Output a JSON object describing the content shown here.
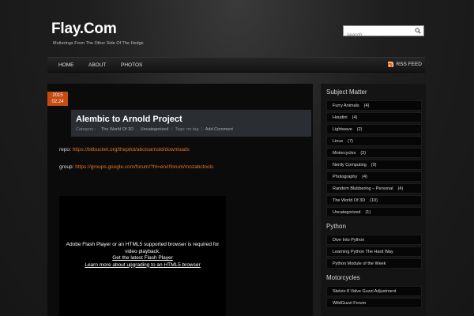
{
  "site": {
    "title": "Flay.Com",
    "tagline": "Mutterings From The Other Side Of The Hedge"
  },
  "search": {
    "placeholder": "search"
  },
  "nav": {
    "items": [
      "HOME",
      "ABOUT",
      "PHOTOS"
    ],
    "rss_label": "RSS FEED"
  },
  "post": {
    "date_year": "2015",
    "date_day": "02.24",
    "title": "Alembic to Arnold Project",
    "meta": {
      "category_label": "Category :",
      "categories": [
        "The World Of 3D",
        "Uncategorized"
      ],
      "tags_label": "Tags: no tag",
      "comment_label": "Add Comment"
    },
    "repo_label": "repo:",
    "repo_url": "https://bitbucket.org/thepilot/abctoarnold/downloads",
    "group_label": "group:",
    "group_url": "https://groups.google.com/forum/?hl=en#!forum/mozabctools",
    "flash": {
      "line1": "Adobe Flash Player or an HTML5 supported browser is required for",
      "line2": "video playback.",
      "link1": "Get the latest Flash Player",
      "link2": "Learn more about upgrading to an HTML5 browser"
    }
  },
  "sidebar": {
    "subject_title": "Subject Matter",
    "subjects": [
      {
        "label": "Furry Animals",
        "count": "(4)"
      },
      {
        "label": "Houdini",
        "count": "(4)"
      },
      {
        "label": "Lightwave",
        "count": "(2)"
      },
      {
        "label": "Linux",
        "count": "(7)"
      },
      {
        "label": "Motorcycles",
        "count": "(3)"
      },
      {
        "label": "Nerdy Computing",
        "count": "(9)"
      },
      {
        "label": "Photography",
        "count": "(4)"
      },
      {
        "label": "Random Blubbering – Personal",
        "count": "(4)"
      },
      {
        "label": "The World Of 3D",
        "count": "(10)"
      },
      {
        "label": "Uncategorized",
        "count": "(1)"
      }
    ],
    "python_title": "Python",
    "python_links": [
      "Dive Into Python",
      "Learning Python The Hard Way",
      "Python Module of the Week"
    ],
    "moto_title": "Motorcycles",
    "moto_links": [
      "Stelvio 8 Valve Guzzi Adjustment",
      "WildGuzzi Forum"
    ]
  },
  "colors": {
    "accent": "#e8751c",
    "date_badge": "#c54b10"
  }
}
